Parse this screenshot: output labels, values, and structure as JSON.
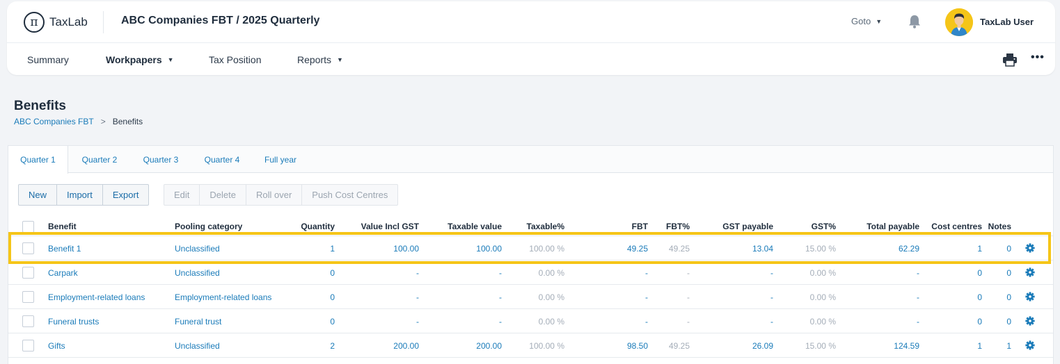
{
  "brand": {
    "name": "TaxLab",
    "glyph": "π"
  },
  "header": {
    "title": "ABC Companies FBT / 2025 Quarterly",
    "goto_label": "Goto",
    "user_name": "TaxLab User"
  },
  "nav": {
    "summary": "Summary",
    "workpapers": "Workpapers",
    "tax_position": "Tax Position",
    "reports": "Reports"
  },
  "page": {
    "title": "Benefits",
    "breadcrumb_root": "ABC Companies FBT",
    "breadcrumb_sep": ">",
    "breadcrumb_current": "Benefits"
  },
  "tabs": [
    "Quarter 1",
    "Quarter 2",
    "Quarter 3",
    "Quarter 4",
    "Full year"
  ],
  "toolbar": {
    "new": "New",
    "import": "Import",
    "export": "Export",
    "edit": "Edit",
    "delete": "Delete",
    "roll_over": "Roll over",
    "push_cost_centres": "Push Cost Centres"
  },
  "table": {
    "columns": {
      "benefit": "Benefit",
      "pooling": "Pooling category",
      "quantity": "Quantity",
      "value_incl_gst": "Value Incl GST",
      "taxable_value": "Taxable value",
      "taxable_pct": "Taxable%",
      "fbt": "FBT",
      "fbt_pct": "FBT%",
      "gst_payable": "GST payable",
      "gst_pct": "GST%",
      "total_payable": "Total payable",
      "cost_centres": "Cost centres",
      "notes": "Notes"
    },
    "rows": [
      {
        "benefit": "Benefit 1",
        "pooling": "Unclassified",
        "quantity": "1",
        "value_incl_gst": "100.00",
        "taxable_value": "100.00",
        "taxable_pct": "100.00 %",
        "fbt": "49.25",
        "fbt_pct": "49.25",
        "gst_payable": "13.04",
        "gst_pct": "15.00 %",
        "total_payable": "62.29",
        "cost_centres": "1",
        "notes": "0"
      },
      {
        "benefit": "Carpark",
        "pooling": "Unclassified",
        "quantity": "0",
        "value_incl_gst": "-",
        "taxable_value": "-",
        "taxable_pct": "0.00 %",
        "fbt": "-",
        "fbt_pct": "-",
        "gst_payable": "-",
        "gst_pct": "0.00 %",
        "total_payable": "-",
        "cost_centres": "0",
        "notes": "0"
      },
      {
        "benefit": "Employment-related loans",
        "pooling": "Employment-related loans",
        "quantity": "0",
        "value_incl_gst": "-",
        "taxable_value": "-",
        "taxable_pct": "0.00 %",
        "fbt": "-",
        "fbt_pct": "-",
        "gst_payable": "-",
        "gst_pct": "0.00 %",
        "total_payable": "-",
        "cost_centres": "0",
        "notes": "0"
      },
      {
        "benefit": "Funeral trusts",
        "pooling": "Funeral trust",
        "quantity": "0",
        "value_incl_gst": "-",
        "taxable_value": "-",
        "taxable_pct": "0.00 %",
        "fbt": "-",
        "fbt_pct": "-",
        "gst_payable": "-",
        "gst_pct": "0.00 %",
        "total_payable": "-",
        "cost_centres": "0",
        "notes": "0"
      },
      {
        "benefit": "Gifts",
        "pooling": "Unclassified",
        "quantity": "2",
        "value_incl_gst": "200.00",
        "taxable_value": "200.00",
        "taxable_pct": "100.00 %",
        "fbt": "98.50",
        "fbt_pct": "49.25",
        "gst_payable": "26.09",
        "gst_pct": "15.00 %",
        "total_payable": "124.59",
        "cost_centres": "1",
        "notes": "1"
      }
    ]
  },
  "colors": {
    "accent": "#1a7bb9",
    "highlight": "#f5c518",
    "muted": "#a4adb8"
  },
  "icons": {
    "bell": "bell-icon",
    "printer": "printer-icon",
    "more": "more-icon",
    "gear": "gear-icon",
    "chevron": "chevron-down-icon"
  }
}
